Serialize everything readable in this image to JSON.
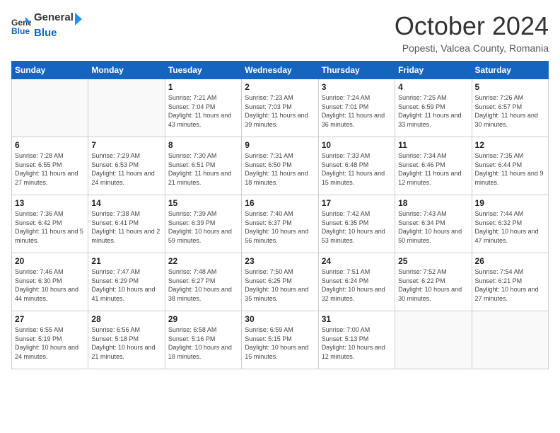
{
  "header": {
    "logo": {
      "general": "General",
      "blue": "Blue"
    },
    "title": "October 2024",
    "location": "Popesti, Valcea County, Romania"
  },
  "weekdays": [
    "Sunday",
    "Monday",
    "Tuesday",
    "Wednesday",
    "Thursday",
    "Friday",
    "Saturday"
  ],
  "weeks": [
    [
      null,
      null,
      {
        "day": 1,
        "sunrise": "7:21 AM",
        "sunset": "7:04 PM",
        "daylight": "11 hours and 43 minutes."
      },
      {
        "day": 2,
        "sunrise": "7:23 AM",
        "sunset": "7:03 PM",
        "daylight": "11 hours and 39 minutes."
      },
      {
        "day": 3,
        "sunrise": "7:24 AM",
        "sunset": "7:01 PM",
        "daylight": "11 hours and 36 minutes."
      },
      {
        "day": 4,
        "sunrise": "7:25 AM",
        "sunset": "6:59 PM",
        "daylight": "11 hours and 33 minutes."
      },
      {
        "day": 5,
        "sunrise": "7:26 AM",
        "sunset": "6:57 PM",
        "daylight": "11 hours and 30 minutes."
      }
    ],
    [
      {
        "day": 6,
        "sunrise": "7:28 AM",
        "sunset": "6:55 PM",
        "daylight": "11 hours and 27 minutes."
      },
      {
        "day": 7,
        "sunrise": "7:29 AM",
        "sunset": "6:53 PM",
        "daylight": "11 hours and 24 minutes."
      },
      {
        "day": 8,
        "sunrise": "7:30 AM",
        "sunset": "6:51 PM",
        "daylight": "11 hours and 21 minutes."
      },
      {
        "day": 9,
        "sunrise": "7:31 AM",
        "sunset": "6:50 PM",
        "daylight": "11 hours and 18 minutes."
      },
      {
        "day": 10,
        "sunrise": "7:33 AM",
        "sunset": "6:48 PM",
        "daylight": "11 hours and 15 minutes."
      },
      {
        "day": 11,
        "sunrise": "7:34 AM",
        "sunset": "6:46 PM",
        "daylight": "11 hours and 12 minutes."
      },
      {
        "day": 12,
        "sunrise": "7:35 AM",
        "sunset": "6:44 PM",
        "daylight": "11 hours and 9 minutes."
      }
    ],
    [
      {
        "day": 13,
        "sunrise": "7:36 AM",
        "sunset": "6:42 PM",
        "daylight": "11 hours and 5 minutes."
      },
      {
        "day": 14,
        "sunrise": "7:38 AM",
        "sunset": "6:41 PM",
        "daylight": "11 hours and 2 minutes."
      },
      {
        "day": 15,
        "sunrise": "7:39 AM",
        "sunset": "6:39 PM",
        "daylight": "10 hours and 59 minutes."
      },
      {
        "day": 16,
        "sunrise": "7:40 AM",
        "sunset": "6:37 PM",
        "daylight": "10 hours and 56 minutes."
      },
      {
        "day": 17,
        "sunrise": "7:42 AM",
        "sunset": "6:35 PM",
        "daylight": "10 hours and 53 minutes."
      },
      {
        "day": 18,
        "sunrise": "7:43 AM",
        "sunset": "6:34 PM",
        "daylight": "10 hours and 50 minutes."
      },
      {
        "day": 19,
        "sunrise": "7:44 AM",
        "sunset": "6:32 PM",
        "daylight": "10 hours and 47 minutes."
      }
    ],
    [
      {
        "day": 20,
        "sunrise": "7:46 AM",
        "sunset": "6:30 PM",
        "daylight": "10 hours and 44 minutes."
      },
      {
        "day": 21,
        "sunrise": "7:47 AM",
        "sunset": "6:29 PM",
        "daylight": "10 hours and 41 minutes."
      },
      {
        "day": 22,
        "sunrise": "7:48 AM",
        "sunset": "6:27 PM",
        "daylight": "10 hours and 38 minutes."
      },
      {
        "day": 23,
        "sunrise": "7:50 AM",
        "sunset": "6:25 PM",
        "daylight": "10 hours and 35 minutes."
      },
      {
        "day": 24,
        "sunrise": "7:51 AM",
        "sunset": "6:24 PM",
        "daylight": "10 hours and 32 minutes."
      },
      {
        "day": 25,
        "sunrise": "7:52 AM",
        "sunset": "6:22 PM",
        "daylight": "10 hours and 30 minutes."
      },
      {
        "day": 26,
        "sunrise": "7:54 AM",
        "sunset": "6:21 PM",
        "daylight": "10 hours and 27 minutes."
      }
    ],
    [
      {
        "day": 27,
        "sunrise": "6:55 AM",
        "sunset": "5:19 PM",
        "daylight": "10 hours and 24 minutes."
      },
      {
        "day": 28,
        "sunrise": "6:56 AM",
        "sunset": "5:18 PM",
        "daylight": "10 hours and 21 minutes."
      },
      {
        "day": 29,
        "sunrise": "6:58 AM",
        "sunset": "5:16 PM",
        "daylight": "10 hours and 18 minutes."
      },
      {
        "day": 30,
        "sunrise": "6:59 AM",
        "sunset": "5:15 PM",
        "daylight": "10 hours and 15 minutes."
      },
      {
        "day": 31,
        "sunrise": "7:00 AM",
        "sunset": "5:13 PM",
        "daylight": "10 hours and 12 minutes."
      },
      null,
      null
    ]
  ]
}
